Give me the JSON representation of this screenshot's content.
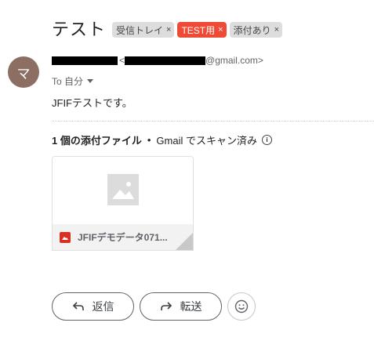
{
  "subject": "テスト",
  "labels": [
    {
      "text": "受信トレイ",
      "close": "×",
      "color": "#dddddd"
    },
    {
      "text": "TEST用",
      "close": "×",
      "color": "#ef4a36"
    },
    {
      "text": "添付あり",
      "close": "×",
      "color": "#dddddd"
    }
  ],
  "sender": {
    "avatar_letter": "マ",
    "avatar_color": "#8d6e63",
    "email_suffix": "@gmail.com>",
    "email_open": "<",
    "to_label": "To 自分"
  },
  "body_text": "JFIFテストです。",
  "attachments": {
    "count_label": "1 個の添付ファイル",
    "separator": "•",
    "scan_label": "Gmail でスキャン済み",
    "info_icon": "info-icon",
    "files": [
      {
        "name": "JFIFデモデータ071...",
        "icon": "image-icon"
      }
    ]
  },
  "actions": {
    "reply_label": "返信",
    "forward_label": "転送",
    "emoji_icon": "smiley-icon"
  }
}
